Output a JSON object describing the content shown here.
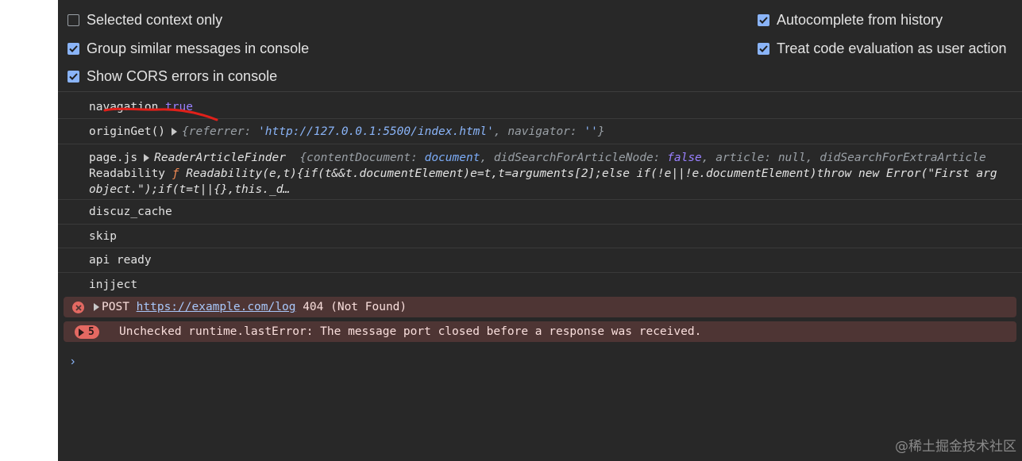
{
  "settings": {
    "selected_context_only": {
      "label": "Selected context only",
      "checked": false
    },
    "group_similar": {
      "label": "Group similar messages in console",
      "checked": true
    },
    "show_cors": {
      "label": "Show CORS errors in console",
      "checked": true
    },
    "autocomplete_history": {
      "label": "Autocomplete from history",
      "checked": true
    },
    "treat_code_eval": {
      "label": "Treat code evaluation as user action",
      "checked": true
    }
  },
  "console": {
    "msg1": {
      "text": "navagation",
      "value": "true"
    },
    "msg2": {
      "text": "originGet()",
      "obj_open": "{referrer: ",
      "referrer": "'http://127.0.0.1:5500/index.html'",
      "sep": ", navigator: ",
      "navigator": "''",
      "close": "}"
    },
    "msg3": {
      "source": "page.js",
      "class_name": "ReaderArticleFinder",
      "k1": "{contentDocument: ",
      "v1": "document",
      "k2": ", didSearchForArticleNode: ",
      "v2": "false",
      "k3": ", article: ",
      "v3": "null",
      "k4": ", didSearchForExtraArticle",
      "line2_label": "Readability",
      "f_symbol": "ƒ",
      "line2_code": "Readability(e,t){if(t&&t.documentElement)e=t,t=arguments[2];else if(!e||!e.documentElement)throw new Error(\"First arg",
      "line3_code": "object.\");if(t=t||{},this._d…"
    },
    "msg4": {
      "text": "discuz_cache"
    },
    "msg5": {
      "text": "skip"
    },
    "msg6": {
      "text": "api ready"
    },
    "msg7": {
      "text": "injject"
    },
    "error1": {
      "method": "POST",
      "url": "https://example.com/log",
      "status": "404 (Not Found)"
    },
    "error2": {
      "count": "5",
      "text": "Unchecked runtime.lastError: The message port closed before a response was received."
    },
    "prompt": "›"
  },
  "watermark": "@稀土掘金技术社区",
  "colors": {
    "background": "#282828",
    "checkbox_on": "#8ab4f8",
    "error_bg": "#4e3534",
    "error_icon": "#e46962",
    "annotation": "#e0201a"
  }
}
